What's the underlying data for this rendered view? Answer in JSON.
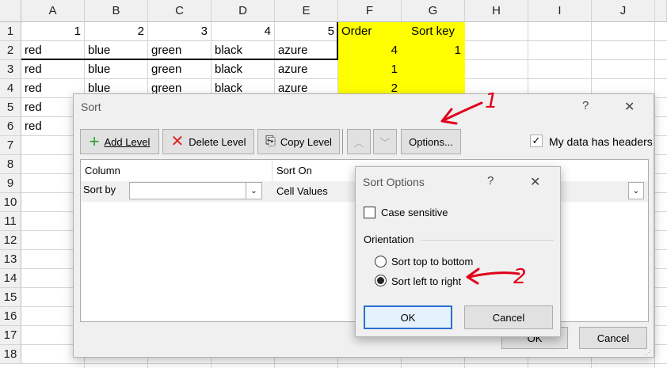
{
  "sheet": {
    "columns": [
      "A",
      "B",
      "C",
      "D",
      "E",
      "F",
      "G",
      "H",
      "I",
      "J"
    ],
    "rows": [
      "1",
      "2",
      "3",
      "4",
      "5",
      "6",
      "7",
      "8",
      "9",
      "10",
      "11",
      "12",
      "13",
      "14",
      "15",
      "16",
      "17",
      "18"
    ],
    "row1": [
      "1",
      "2",
      "3",
      "4",
      "5",
      "Order",
      "Sort key"
    ],
    "row2": [
      "red",
      "blue",
      "green",
      "black",
      "azure",
      "4",
      "1"
    ],
    "row3": [
      "red",
      "blue",
      "green",
      "black",
      "azure",
      "1"
    ],
    "row4": [
      "red",
      "blue",
      "green",
      "black",
      "azure",
      "2"
    ],
    "row5": [
      "red"
    ],
    "row6": [
      "red"
    ],
    "highlight_color": "#ffff00"
  },
  "sort_dialog": {
    "title": "Sort",
    "help": "?",
    "close": "✕",
    "toolbar": {
      "add_level": "Add Level",
      "delete_level": "Delete Level",
      "copy_level": "Copy Level",
      "options": "Options...",
      "my_data_has_headers": "My data has headers"
    },
    "headers": {
      "column": "Column",
      "sort_on": "Sort On"
    },
    "row": {
      "sort_by": "Sort by",
      "sort_on_value": "Cell Values"
    },
    "ok": "OK",
    "cancel": "Cancel"
  },
  "options_dialog": {
    "title": "Sort Options",
    "help": "?",
    "close": "✕",
    "case_sensitive": "Case sensitive",
    "orientation": "Orientation",
    "top_to_bottom": "Sort top to bottom",
    "left_to_right": "Sort left to right",
    "ok": "OK",
    "cancel": "Cancel"
  },
  "annotations": {
    "arrow1_label": "1",
    "arrow2_label": "2",
    "color": "#e0001b"
  }
}
